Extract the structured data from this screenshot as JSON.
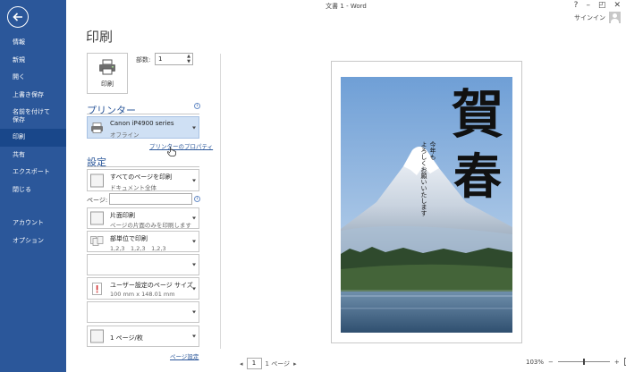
{
  "window": {
    "title": "文書 1 - Word",
    "help": "?",
    "minimize": "–",
    "restore": "◰",
    "close": "✕",
    "signin": "サインイン"
  },
  "sidebar": {
    "items": [
      {
        "label": "情報"
      },
      {
        "label": "新規"
      },
      {
        "label": "開く"
      },
      {
        "label": "上書き保存"
      },
      {
        "label": "名前を付けて"
      },
      {
        "label": "保存"
      },
      {
        "label": "印刷"
      },
      {
        "label": "共有"
      },
      {
        "label": "エクスポート"
      },
      {
        "label": "閉じる"
      },
      {
        "label": "アカウント"
      },
      {
        "label": "オプション"
      }
    ]
  },
  "print": {
    "title": "印刷",
    "button_label": "印刷",
    "copies_label": "部数:",
    "copies_value": "1"
  },
  "printer": {
    "section_title": "プリンター",
    "name": "Canon iP4900 series",
    "status": "オフライン",
    "properties_link": "プリンターのプロパティ"
  },
  "settings": {
    "section_title": "設定",
    "print_range": {
      "title": "すべてのページを印刷",
      "subtitle": "ドキュメント全体"
    },
    "pages_label": "ページ:",
    "sides": {
      "title": "片面印刷",
      "subtitle": "ページの片面のみを印刷します"
    },
    "collation": {
      "title": "部単位で印刷",
      "subtitle": "1,2,3　1,2,3　1,2,3"
    },
    "paper_size": {
      "title": "ユーザー設定のページ サイズ",
      "subtitle": "100 mm x 148.01 mm"
    },
    "pages_per_sheet": {
      "title": "1 ページ/枚"
    },
    "page_setup_link": "ページ設定"
  },
  "card": {
    "kanji_1": "賀",
    "kanji_2": "春",
    "greeting_1": "今年も",
    "greeting_2": "よろしくお願いいたします"
  },
  "preview": {
    "current_page": "1",
    "total_pages": "1 ページ",
    "zoom_level": "103%",
    "zoom_minus": "−",
    "zoom_plus": "+"
  },
  "colors": {
    "accent": "#2b579a",
    "sidebar_active": "#19478a",
    "printer_highlight": "#cfe0f4"
  }
}
